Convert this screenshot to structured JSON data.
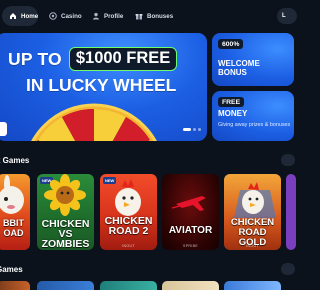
{
  "nav": {
    "home": "Home",
    "casino": "Casino",
    "profile": "Profile",
    "bonuses": "Bonuses",
    "edge_initial": "L"
  },
  "hero": {
    "line1_prefix": "UP TO",
    "amount": "$1000 FREE",
    "line2": "IN LUCKY WHEEL",
    "active_slide": 1,
    "slide_count": 3
  },
  "promos": [
    {
      "tag": "600%",
      "title_1": "WELCOME",
      "title_2": "BONUS"
    },
    {
      "tag": "FREE",
      "title_1": "MONEY",
      "subtitle": "Giving away prizes & bonuses"
    }
  ],
  "sections": {
    "row1_title": "k Games",
    "row2_title": "Games"
  },
  "games": [
    {
      "caption_1": "BBIT",
      "caption_2": "OAD",
      "brand": ""
    },
    {
      "caption_1": "CHICKEN",
      "caption_2": "VS ZOMBIES",
      "brand": "INOUT",
      "badge": "NEW"
    },
    {
      "caption_1": "CHICKEN",
      "caption_2": "ROAD 2",
      "brand": "INOUT",
      "badge": "NEW"
    },
    {
      "caption_1": "AVIATOR",
      "caption_2": "",
      "brand": "SPRIBE"
    },
    {
      "caption_1": "CHICKEN",
      "caption_2": "ROAD GOLD",
      "brand": "INOUT"
    }
  ],
  "colors": {
    "background": "#0b121c",
    "nav_active": "#1e2836",
    "banner_blue": "#1c5fe4",
    "amount_border": "#6aff6a"
  }
}
